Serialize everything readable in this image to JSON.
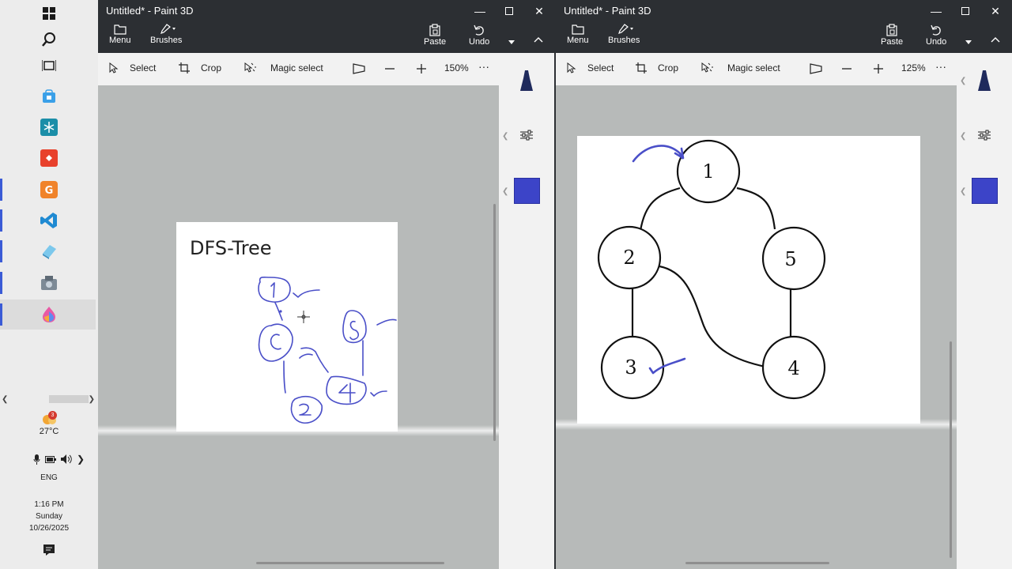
{
  "taskbar": {
    "weather_badge": "3",
    "temperature": "27°C",
    "language": "ENG",
    "time": "1:16 PM",
    "day": "Sunday",
    "date": "10/26/2025"
  },
  "left_window": {
    "title": "Untitled* - Paint 3D",
    "ribbon": {
      "menu": "Menu",
      "brushes": "Brushes",
      "paste": "Paste",
      "undo": "Undo"
    },
    "toolbar": {
      "select": "Select",
      "crop": "Crop",
      "magic_select": "Magic select",
      "zoom": "150%",
      "more": "···"
    },
    "canvas_title": "DFS-Tree",
    "color": "#3c44c8"
  },
  "right_window": {
    "title": "Untitled* - Paint 3D",
    "ribbon": {
      "menu": "Menu",
      "brushes": "Brushes",
      "paste": "Paste",
      "undo": "Undo"
    },
    "toolbar": {
      "select": "Select",
      "crop": "Crop",
      "magic_select": "Magic select",
      "zoom": "125%",
      "more": "···"
    },
    "graph": {
      "nodes": [
        {
          "label": "1"
        },
        {
          "label": "2"
        },
        {
          "label": "5"
        },
        {
          "label": "3"
        },
        {
          "label": "4"
        }
      ]
    },
    "color": "#3c44c8"
  }
}
